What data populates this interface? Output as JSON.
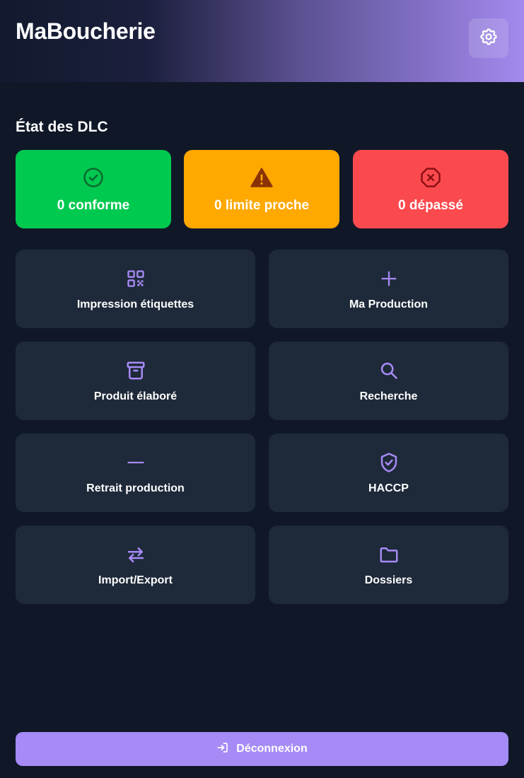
{
  "app": {
    "title": "MaBoucherie"
  },
  "header": {
    "settings_icon": "gear-icon",
    "gradient_start": "#101828",
    "gradient_end": "#a389ee"
  },
  "dlc": {
    "title": "État des DLC",
    "cards": [
      {
        "label": "0 conforme",
        "icon": "check-circle-icon",
        "color": "#00c950"
      },
      {
        "label": "0 limite proche",
        "icon": "warning-triangle-icon",
        "color": "#fea800"
      },
      {
        "label": "0 dépassé",
        "icon": "x-octagon-icon",
        "color": "#fb4a4e"
      }
    ]
  },
  "menu": {
    "tiles": [
      {
        "label": "Impression étiquettes",
        "icon": "qr-code-icon"
      },
      {
        "label": "Ma Production",
        "icon": "plus-icon"
      },
      {
        "label": "Produit élaboré",
        "icon": "archive-box-icon"
      },
      {
        "label": "Recherche",
        "icon": "search-icon"
      },
      {
        "label": "Retrait production",
        "icon": "minus-icon"
      },
      {
        "label": "HACCP",
        "icon": "shield-check-icon"
      },
      {
        "label": "Import/Export",
        "icon": "arrows-exchange-icon"
      },
      {
        "label": "Dossiers",
        "icon": "folder-icon"
      }
    ]
  },
  "logout": {
    "label": "Déconnexion",
    "icon": "logout-icon",
    "color": "#a68bf6"
  },
  "colors": {
    "background": "#101828",
    "tile": "#1e2939",
    "accent": "#a68bf6"
  }
}
